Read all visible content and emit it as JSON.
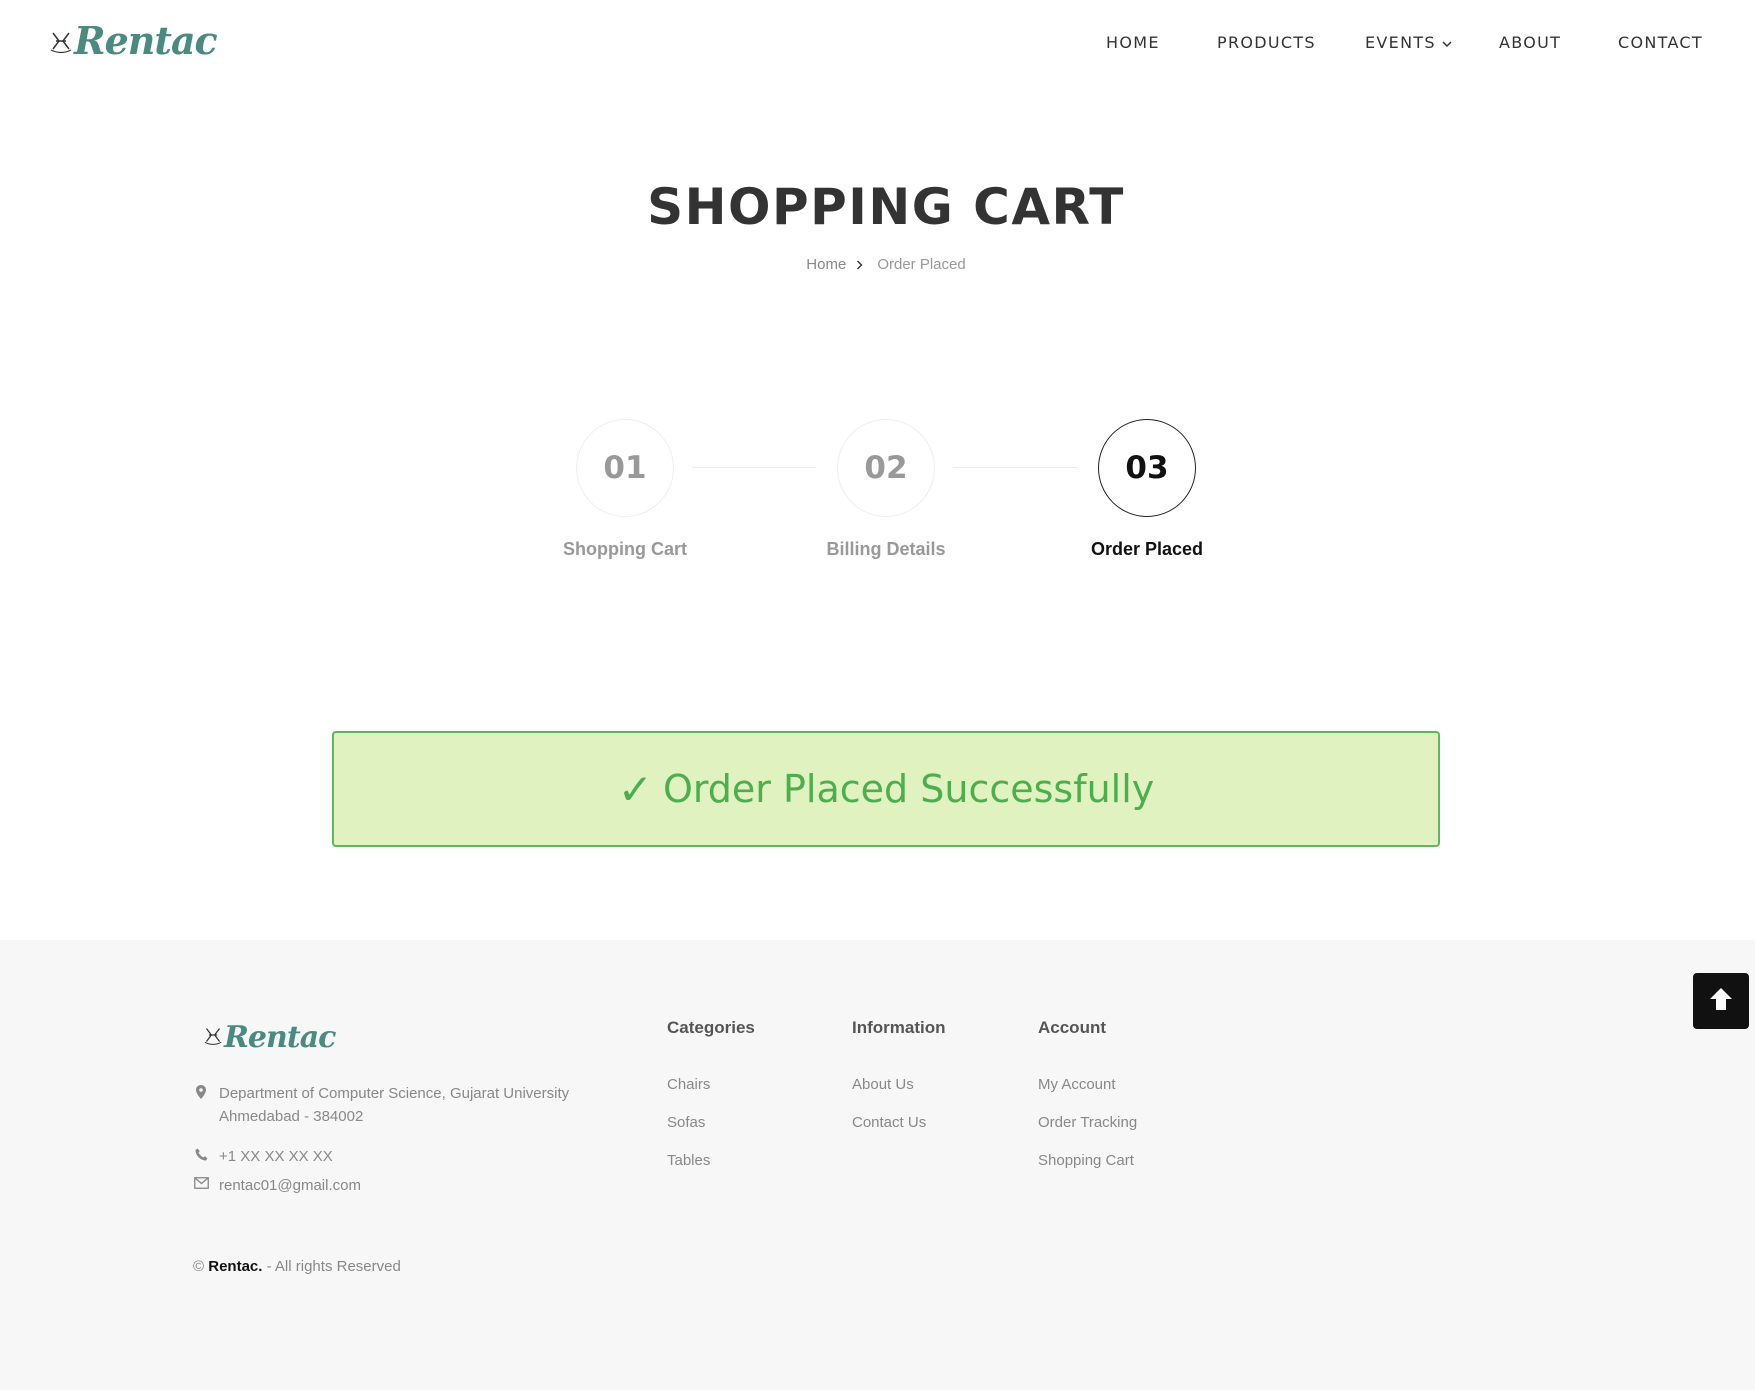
{
  "brand": {
    "name": "Rentac",
    "icon": "rocking-horse-icon"
  },
  "nav": {
    "items": [
      {
        "label": "HOME"
      },
      {
        "label": "PRODUCTS"
      },
      {
        "label": "EVENTS"
      },
      {
        "label": "ABOUT"
      },
      {
        "label": "CONTACT"
      }
    ]
  },
  "page": {
    "title": "SHOPPING CART",
    "breadcrumb": {
      "home": "Home",
      "current": "Order Placed"
    }
  },
  "steps": [
    {
      "number": "01",
      "label": "Shopping Cart",
      "state": "inactive"
    },
    {
      "number": "02",
      "label": "Billing Details",
      "state": "inactive"
    },
    {
      "number": "03",
      "label": "Order Placed",
      "state": "active"
    }
  ],
  "success": {
    "check": "✓",
    "message": "Order Placed Successfully"
  },
  "footer": {
    "address_line1": "Department of Computer Science, Gujarat University",
    "address_line2": "Ahmedabad - 384002",
    "phone": "+1 XX XX XX XX",
    "email": "rentac01@gmail.com",
    "columns": [
      {
        "title": "Categories",
        "links": [
          "Chairs",
          "Sofas",
          "Tables"
        ]
      },
      {
        "title": "Information",
        "links": [
          "About Us",
          "Contact Us"
        ]
      },
      {
        "title": "Account",
        "links": [
          "My Account",
          "Order Tracking",
          "Shopping Cart"
        ]
      }
    ],
    "copyright": {
      "symbol": "©",
      "brand": "Rentac.",
      "text": "- All rights Reserved"
    }
  },
  "colors": {
    "brand_teal": "#4a8a80",
    "success_green": "#4cae4c",
    "success_bg": "#dff2bf",
    "footer_bg": "#f7f7f7"
  }
}
